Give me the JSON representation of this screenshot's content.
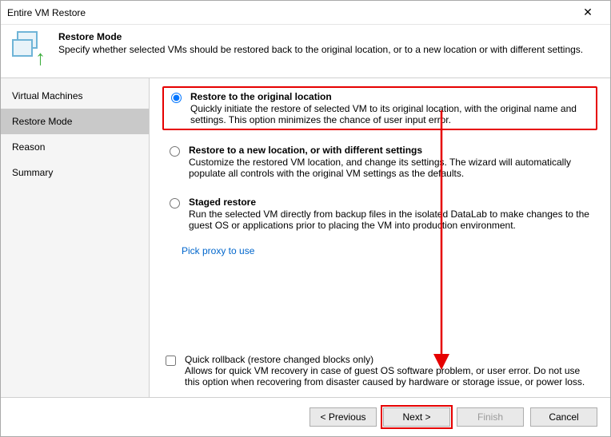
{
  "window": {
    "title": "Entire VM Restore"
  },
  "header": {
    "heading": "Restore Mode",
    "description": "Specify whether selected VMs should be restored back to the original location, or to a new location or with different settings."
  },
  "sidebar": {
    "items": [
      {
        "label": "Virtual Machines"
      },
      {
        "label": "Restore Mode"
      },
      {
        "label": "Reason"
      },
      {
        "label": "Summary"
      }
    ],
    "activeIndex": 1
  },
  "options": {
    "original": {
      "title": "Restore to the original location",
      "desc": "Quickly initiate the restore of selected VM to its original location, with the original name and settings. This option minimizes the chance of user input error."
    },
    "newloc": {
      "title": "Restore to a new location, or with different settings",
      "desc": "Customize the restored VM location, and change its settings. The wizard will automatically populate all controls with the original VM settings as the defaults."
    },
    "staged": {
      "title": "Staged restore",
      "desc": "Run the selected VM directly from backup files in the isolated DataLab to make changes to the guest OS or applications prior to placing the VM into production environment."
    },
    "proxy_link": "Pick proxy to use"
  },
  "rollback": {
    "label": "Quick rollback (restore changed blocks only)",
    "desc": "Allows for quick VM recovery in case of guest OS software problem, or user error. Do not use this option when recovering from disaster caused by hardware or storage issue, or power loss."
  },
  "buttons": {
    "previous": "< Previous",
    "next": "Next >",
    "finish": "Finish",
    "cancel": "Cancel"
  }
}
